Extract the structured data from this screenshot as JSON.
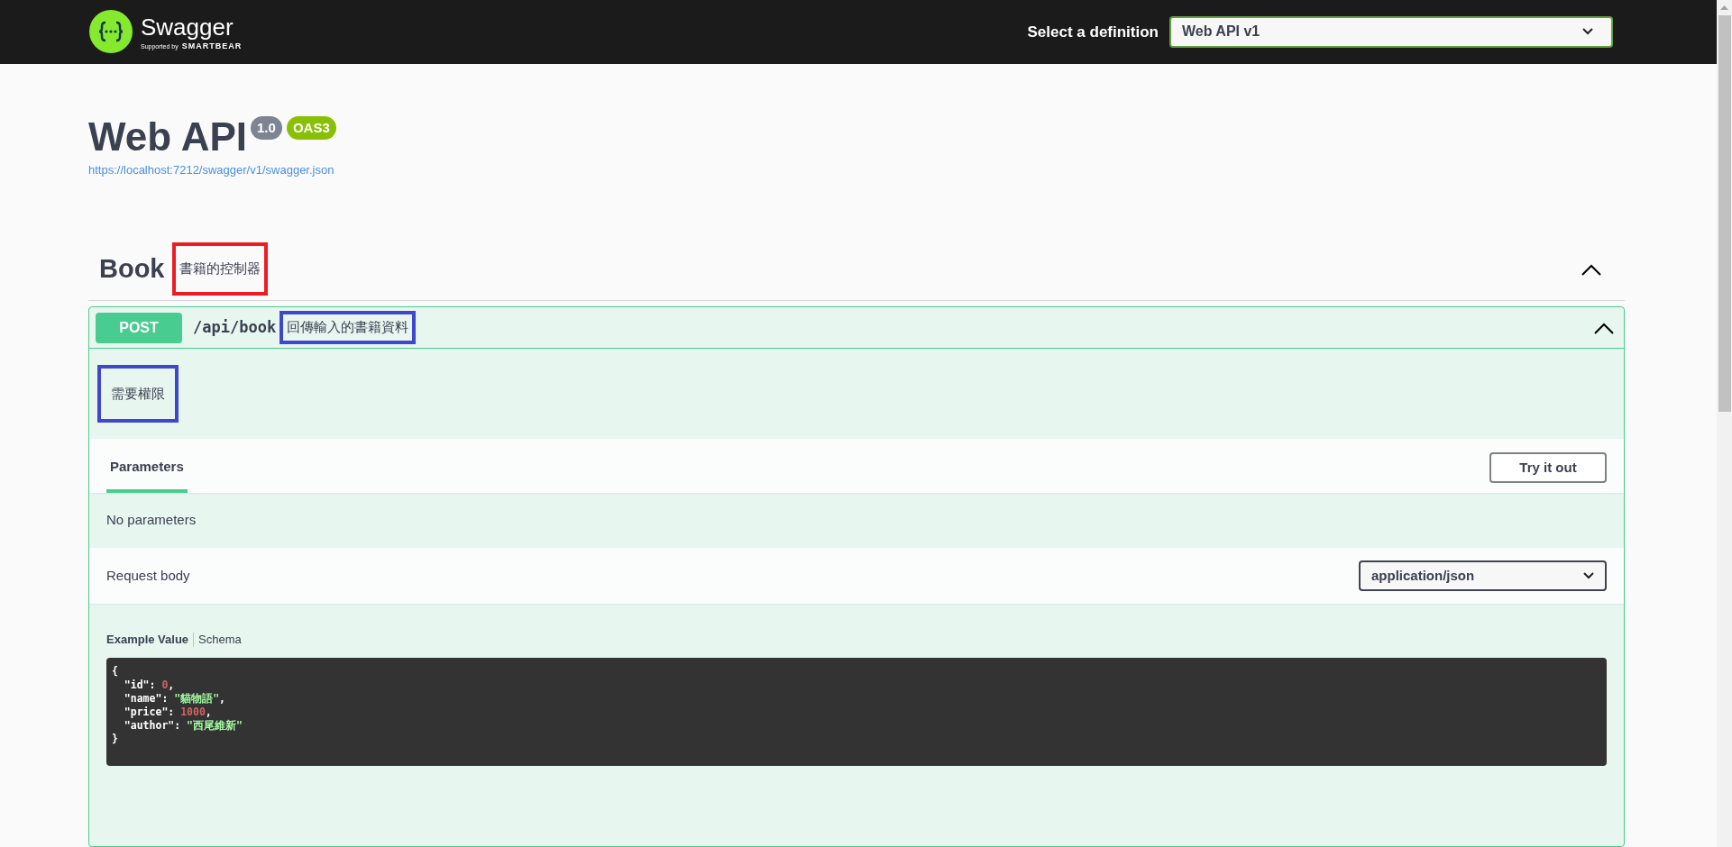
{
  "topbar": {
    "logo_text": "Swagger",
    "logo_subtext": "Supported by",
    "logo_brand": "SMARTBEAR",
    "definition_label": "Select a definition",
    "definition_value": "Web API v1"
  },
  "info": {
    "title": "Web API",
    "version": "1.0",
    "spec": "OAS3",
    "url": "https://localhost:7212/swagger/v1/swagger.json"
  },
  "tag": {
    "name": "Book",
    "description": {
      "text": "書籍的控制器",
      "color": "#ed1c24"
    },
    "expanded": true
  },
  "operation": {
    "method": "POST",
    "path": "/api/book",
    "summary": {
      "text": "回傳輸入的書籍資料",
      "color": "#3f48cc"
    },
    "expanded": true,
    "description": {
      "text": "需要權限",
      "color": "#3f48cc"
    },
    "tabs": [
      {
        "label": "Parameters",
        "selected": true
      }
    ],
    "try_button": "Try it out",
    "parameters_text": "No parameters",
    "request_body_label": "Request body",
    "content_type": "application/json",
    "example_tabs": [
      {
        "label": "Example Value",
        "selected": true
      },
      {
        "label": "Schema",
        "selected": false
      }
    ],
    "example_lines": [
      {
        "kind": "punct",
        "text": "{"
      },
      {
        "kind": "number",
        "key": "\"id\":",
        "value": "0",
        "trail": ","
      },
      {
        "kind": "string",
        "key": "\"name\":",
        "value": "\"貓物語\"",
        "trail": ","
      },
      {
        "kind": "number",
        "key": "\"price\":",
        "value": "1000",
        "trail": ","
      },
      {
        "kind": "string",
        "key": "\"author\":",
        "value": "\"西尾維新\""
      },
      {
        "kind": "punct",
        "text": "}"
      }
    ]
  }
}
